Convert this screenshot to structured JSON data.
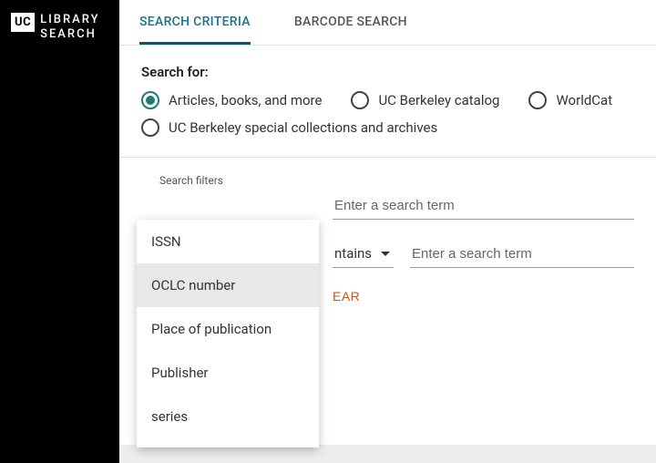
{
  "brand": {
    "badge": "UC",
    "line1": "LIBRARY",
    "line2": "SEARCH"
  },
  "tabs": {
    "search_criteria": "SEARCH CRITERIA",
    "barcode_search": "BARCODE SEARCH"
  },
  "search_for": {
    "label": "Search for:",
    "options": {
      "articles": "Articles, books, and more",
      "catalog": "UC Berkeley catalog",
      "worldcat": "WorldCat",
      "special": "UC Berkeley special collections and archives"
    }
  },
  "filters": {
    "heading": "Search filters",
    "row1": {
      "term_placeholder": "Enter a search term"
    },
    "row2": {
      "contains_label": "ntains",
      "term_placeholder": "Enter a search term"
    }
  },
  "actions": {
    "clear": "EAR"
  },
  "dropdown": {
    "items": [
      "ISSN",
      "OCLC number",
      "Place of publication",
      "Publisher",
      "series"
    ]
  }
}
